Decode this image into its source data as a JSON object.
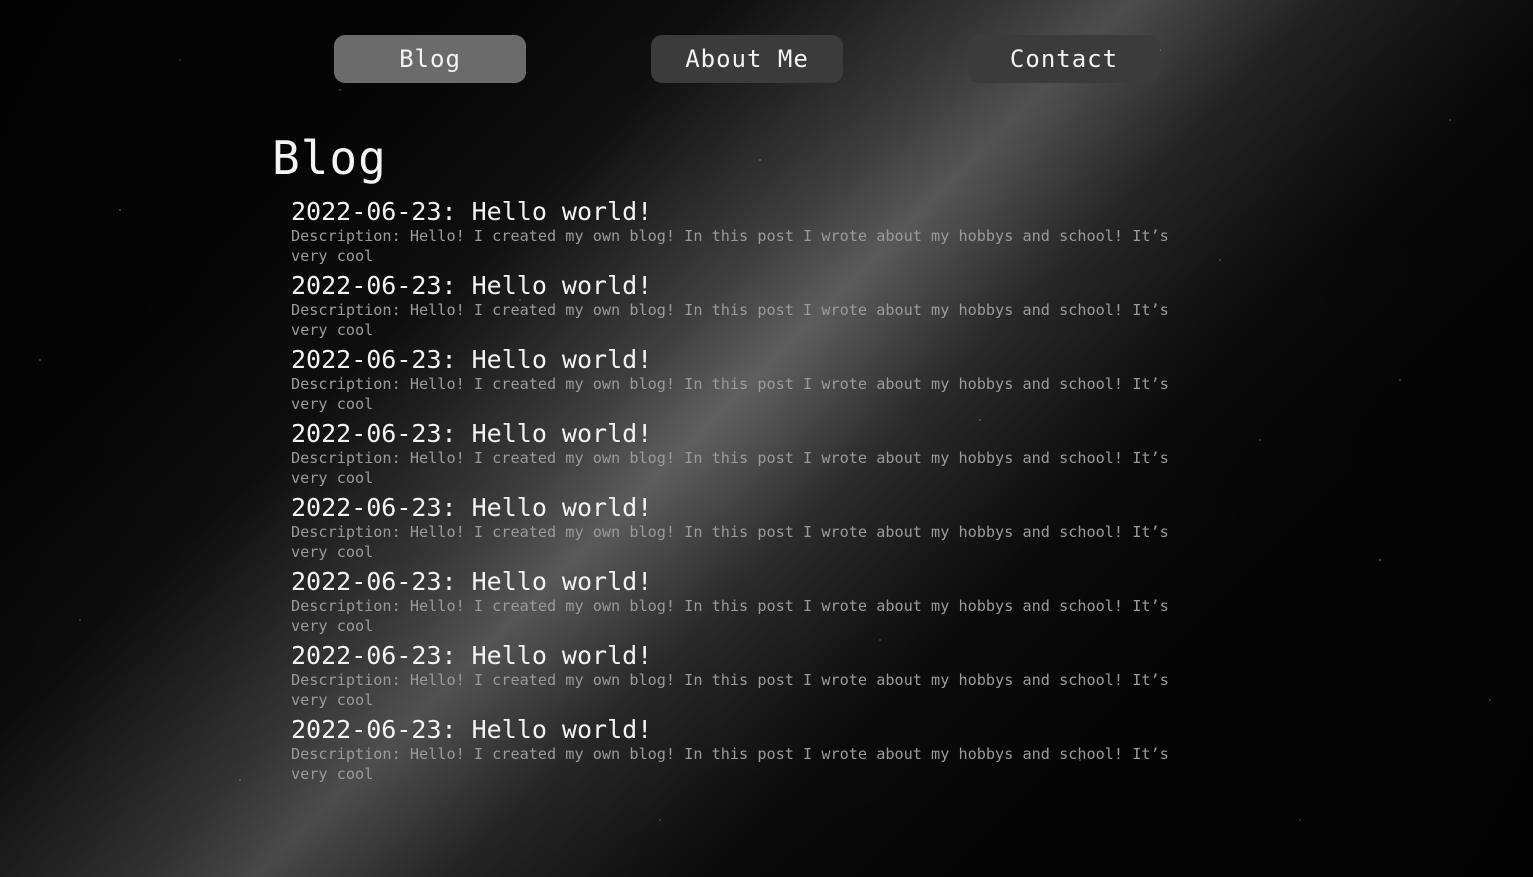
{
  "nav": {
    "items": [
      {
        "label": "Blog"
      },
      {
        "label": "About Me"
      },
      {
        "label": "Contact"
      }
    ]
  },
  "page": {
    "title": "Blog"
  },
  "posts": [
    {
      "title": "2022-06-23: Hello world!",
      "description": "Description: Hello! I created my own blog! In this post I wrote about my hobbys and school! It’s very cool"
    },
    {
      "title": "2022-06-23: Hello world!",
      "description": "Description: Hello! I created my own blog! In this post I wrote about my hobbys and school! It’s very cool"
    },
    {
      "title": "2022-06-23: Hello world!",
      "description": "Description: Hello! I created my own blog! In this post I wrote about my hobbys and school! It’s very cool"
    },
    {
      "title": "2022-06-23: Hello world!",
      "description": "Description: Hello! I created my own blog! In this post I wrote about my hobbys and school! It’s very cool"
    },
    {
      "title": "2022-06-23: Hello world!",
      "description": "Description: Hello! I created my own blog! In this post I wrote about my hobbys and school! It’s very cool"
    },
    {
      "title": "2022-06-23: Hello world!",
      "description": "Description: Hello! I created my own blog! In this post I wrote about my hobbys and school! It’s very cool"
    },
    {
      "title": "2022-06-23: Hello world!",
      "description": "Description: Hello! I created my own blog! In this post I wrote about my hobbys and school! It’s very cool"
    },
    {
      "title": "2022-06-23: Hello world!",
      "description": "Description: Hello! I created my own blog! In this post I wrote about my hobbys and school! It’s very cool"
    }
  ],
  "colors": {
    "background": "#050505",
    "nav_button": "#3b3b3b",
    "nav_button_active": "#6b6b6b",
    "text": "#f4f4f4",
    "muted_text": "#9a9a9a"
  }
}
